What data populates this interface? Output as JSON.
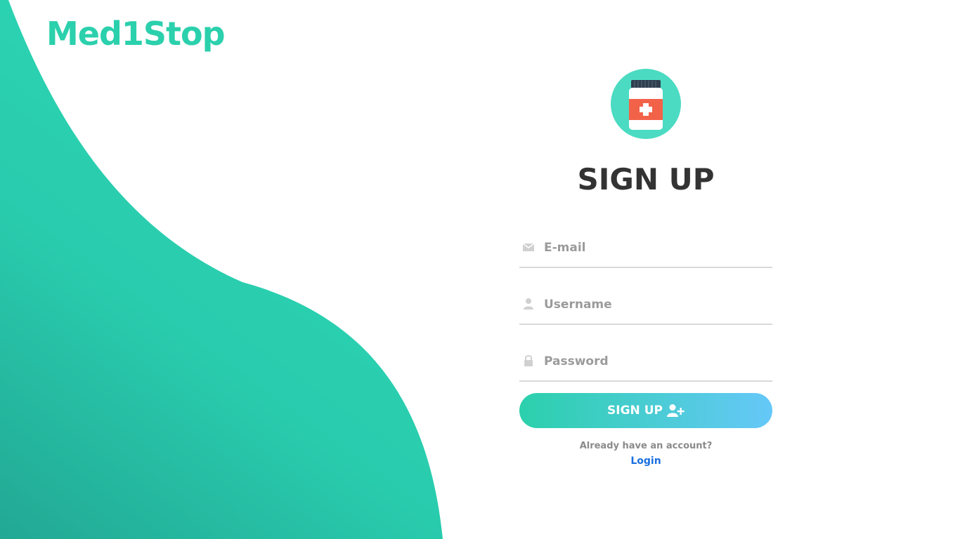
{
  "brand": {
    "name": "Med1Stop"
  },
  "colors": {
    "accent": "#2bd0ac",
    "gradient_end": "#66c8f8",
    "link": "#1a6fe0",
    "title": "#333333"
  },
  "logo": {
    "icon": "medicine-bottle-icon"
  },
  "form": {
    "title": "SIGN UP",
    "email": {
      "placeholder": "E-mail",
      "value": "",
      "icon": "envelope-icon"
    },
    "username": {
      "placeholder": "Username",
      "value": "",
      "icon": "user-icon"
    },
    "password": {
      "placeholder": "Password",
      "value": "",
      "icon": "lock-icon"
    },
    "submit_label": "SIGN UP",
    "submit_icon": "user-plus-icon",
    "already_text": "Already have an account?",
    "login_label": "Login"
  }
}
